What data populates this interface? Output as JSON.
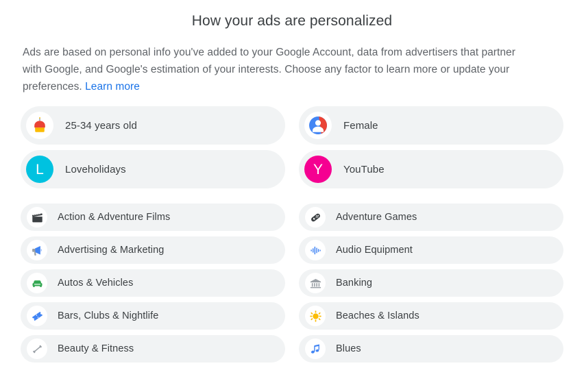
{
  "header": {
    "title": "How your ads are personalized",
    "description_before_link": "Ads are based on personal info you've added to your Google Account, data from advertisers that partner with Google, and Google's estimation of your interests. Choose any factor to learn more or update your preferences. ",
    "learn_more_label": "Learn more"
  },
  "colors": {
    "card_background": "#f1f3f4",
    "link_blue": "#1a73e8",
    "text_primary": "#3c4043",
    "text_secondary": "#5f6368",
    "loveholidays_cyan": "#00c2e0",
    "youtube_magenta": "#f50091",
    "accent_blue": "#4285f4",
    "accent_green": "#34a853",
    "accent_yellow": "#fbbc04",
    "accent_red": "#ea4335",
    "icon_gray": "#9aa0a6",
    "icon_dark": "#3c4043"
  },
  "left_column": {
    "primary": [
      {
        "label": "25-34 years old",
        "icon": "birthday-cake-icon",
        "icon_style": "white-circle"
      },
      {
        "label": "Loveholidays",
        "icon": "monogram-avatar",
        "monogram": "L",
        "color": "#00c2e0"
      }
    ],
    "interests": [
      {
        "label": "Action & Adventure Films",
        "icon": "clapperboard-icon"
      },
      {
        "label": "Advertising & Marketing",
        "icon": "megaphone-icon"
      },
      {
        "label": "Autos & Vehicles",
        "icon": "car-icon"
      },
      {
        "label": "Bars, Clubs & Nightlife",
        "icon": "ticket-icon"
      },
      {
        "label": "Beauty & Fitness",
        "icon": "dumbbell-icon"
      }
    ]
  },
  "right_column": {
    "primary": [
      {
        "label": "Female",
        "icon": "person-gender-icon",
        "icon_style": "white-circle"
      },
      {
        "label": "YouTube",
        "icon": "monogram-avatar",
        "monogram": "Y",
        "color": "#f50091"
      }
    ],
    "interests": [
      {
        "label": "Adventure Games",
        "icon": "gamepad-icon"
      },
      {
        "label": "Audio Equipment",
        "icon": "audio-waveform-icon"
      },
      {
        "label": "Banking",
        "icon": "bank-building-icon"
      },
      {
        "label": "Beaches & Islands",
        "icon": "sun-icon"
      },
      {
        "label": "Blues",
        "icon": "music-note-icon"
      }
    ]
  }
}
